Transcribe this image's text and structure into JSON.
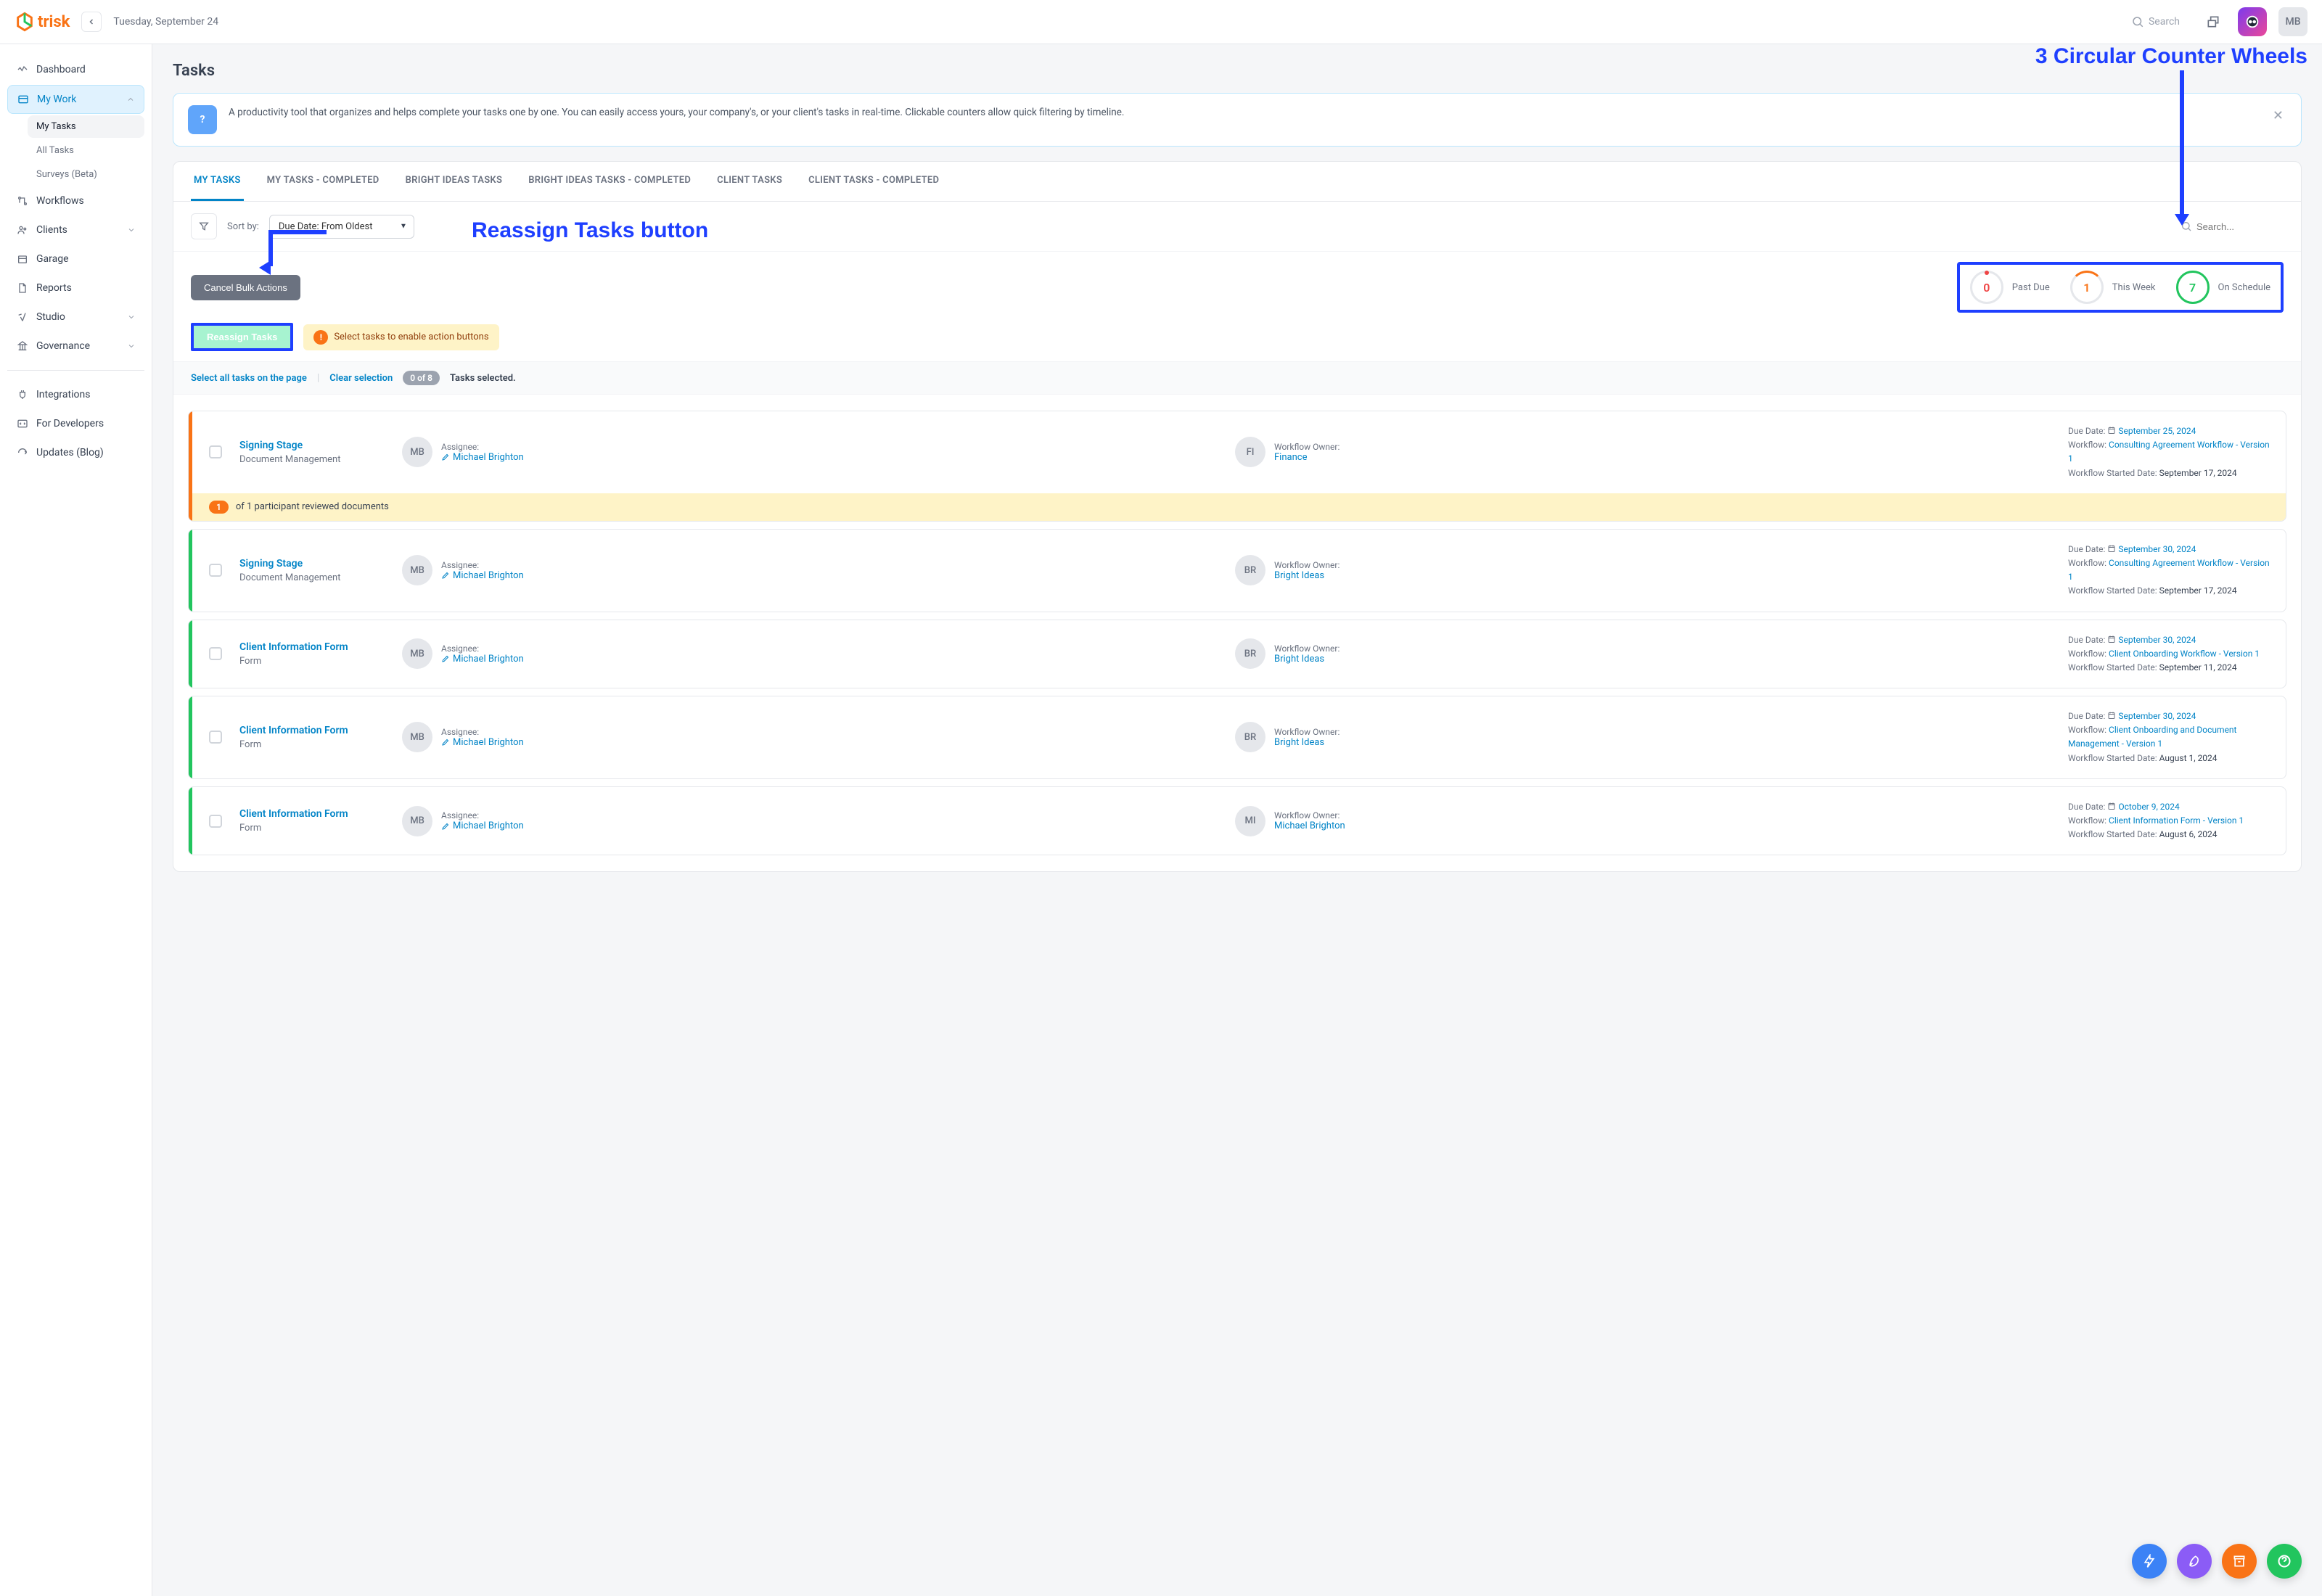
{
  "header": {
    "brand": "trisk",
    "date": "Tuesday, September 24",
    "search_placeholder": "Search",
    "user_initials": "MB"
  },
  "sidebar": {
    "items": [
      {
        "label": "Dashboard"
      },
      {
        "label": "My Work"
      },
      {
        "label": "Workflows"
      },
      {
        "label": "Clients"
      },
      {
        "label": "Garage"
      },
      {
        "label": "Reports"
      },
      {
        "label": "Studio"
      },
      {
        "label": "Governance"
      },
      {
        "label": "Integrations"
      },
      {
        "label": "For Developers"
      },
      {
        "label": "Updates (Blog)"
      }
    ],
    "mywork_sub": [
      {
        "label": "My Tasks"
      },
      {
        "label": "All Tasks"
      },
      {
        "label": "Surveys (Beta)"
      }
    ]
  },
  "page": {
    "title": "Tasks",
    "info": "A productivity tool that organizes and helps complete your tasks one by one. You can easily access yours, your company's, or your client's tasks in real-time. Clickable counters allow quick filtering by timeline."
  },
  "tabs": [
    {
      "label": "MY TASKS"
    },
    {
      "label": "MY TASKS - COMPLETED"
    },
    {
      "label": "BRIGHT IDEAS TASKS"
    },
    {
      "label": "BRIGHT IDEAS TASKS - COMPLETED"
    },
    {
      "label": "CLIENT TASKS"
    },
    {
      "label": "CLIENT TASKS - COMPLETED"
    }
  ],
  "filter": {
    "sort_label": "Sort by:",
    "sort_value": "Due Date: From Oldest",
    "search_placeholder": "Search..."
  },
  "actions": {
    "cancel": "Cancel Bulk Actions",
    "reassign": "Reassign Tasks",
    "warn": "Select tasks to enable action buttons",
    "select_all": "Select all tasks on the page",
    "clear": "Clear selection",
    "count_pill": "0 of 8",
    "selected_label": "Tasks selected."
  },
  "counters": [
    {
      "value": "0",
      "label": "Past Due",
      "style": "red"
    },
    {
      "value": "1",
      "label": "This Week",
      "style": "orange"
    },
    {
      "value": "7",
      "label": "On Schedule",
      "style": "green"
    }
  ],
  "tasks": [
    {
      "stripe": "orange",
      "title": "Signing Stage",
      "subtitle": "Document Management",
      "assignee_initials": "MB",
      "assignee_label": "Assignee:",
      "assignee_name": "Michael Brighton",
      "owner_initials": "FI",
      "owner_label": "Workflow Owner:",
      "owner_name": "Finance",
      "due_label": "Due Date:",
      "due_date": "September 25, 2024",
      "wf_label": "Workflow:",
      "wf_name": "Consulting Agreement Workflow - Version 1",
      "start_label": "Workflow Started Date:",
      "start_date": "September 17, 2024",
      "participant_badge": "1",
      "participant_text": "of 1 participant reviewed documents"
    },
    {
      "stripe": "green",
      "title": "Signing Stage",
      "subtitle": "Document Management",
      "assignee_initials": "MB",
      "assignee_label": "Assignee:",
      "assignee_name": "Michael Brighton",
      "owner_initials": "BR",
      "owner_label": "Workflow Owner:",
      "owner_name": "Bright Ideas",
      "due_label": "Due Date:",
      "due_date": "September 30, 2024",
      "wf_label": "Workflow:",
      "wf_name": "Consulting Agreement Workflow - Version 1",
      "start_label": "Workflow Started Date:",
      "start_date": "September 17, 2024"
    },
    {
      "stripe": "green",
      "title": "Client Information Form",
      "subtitle": "Form",
      "assignee_initials": "MB",
      "assignee_label": "Assignee:",
      "assignee_name": "Michael Brighton",
      "owner_initials": "BR",
      "owner_label": "Workflow Owner:",
      "owner_name": "Bright Ideas",
      "due_label": "Due Date:",
      "due_date": "September 30, 2024",
      "wf_label": "Workflow:",
      "wf_name": "Client Onboarding Workflow - Version 1",
      "start_label": "Workflow Started Date:",
      "start_date": "September 11, 2024"
    },
    {
      "stripe": "green",
      "title": "Client Information Form",
      "subtitle": "Form",
      "assignee_initials": "MB",
      "assignee_label": "Assignee:",
      "assignee_name": "Michael Brighton",
      "owner_initials": "BR",
      "owner_label": "Workflow Owner:",
      "owner_name": "Bright Ideas",
      "due_label": "Due Date:",
      "due_date": "September 30, 2024",
      "wf_label": "Workflow:",
      "wf_name": "Client Onboarding and Document Management - Version 1",
      "start_label": "Workflow Started Date:",
      "start_date": "August 1, 2024"
    },
    {
      "stripe": "green",
      "title": "Client Information Form",
      "subtitle": "Form",
      "assignee_initials": "MB",
      "assignee_label": "Assignee:",
      "assignee_name": "Michael Brighton",
      "owner_initials": "MI",
      "owner_label": "Workflow Owner:",
      "owner_name": "Michael Brighton",
      "due_label": "Due Date:",
      "due_date": "October 9, 2024",
      "wf_label": "Workflow:",
      "wf_name": "Client Information Form - Version 1",
      "start_label": "Workflow Started Date:",
      "start_date": "August 6, 2024"
    }
  ],
  "annotations": {
    "counters": "3 Circular Counter Wheels",
    "reassign": "Reassign Tasks button"
  }
}
